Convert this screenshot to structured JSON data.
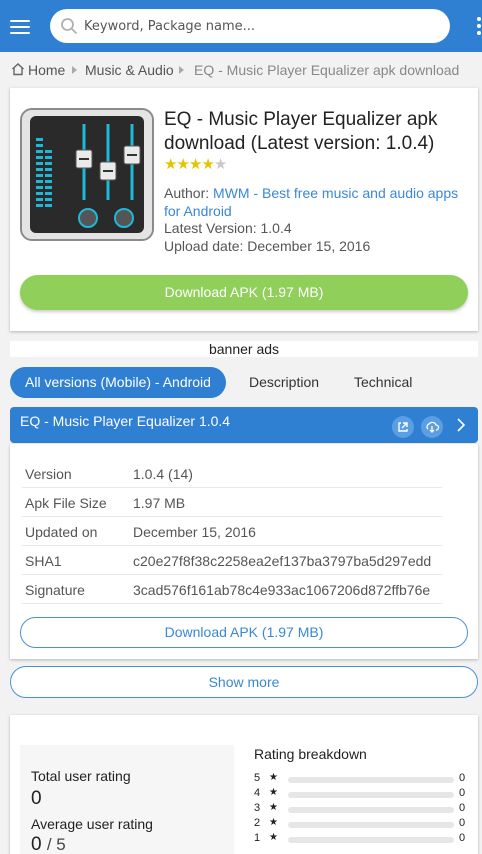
{
  "search": {
    "placeholder": "Keyword, Package name..."
  },
  "breadcrumb": {
    "home": "Home",
    "category": "Music & Audio",
    "current": "EQ - Music Player Equalizer apk download"
  },
  "app": {
    "title": "EQ - Music Player Equalizer apk download (Latest version: 1.0.4)",
    "rating_stars": 4,
    "rating_max": 5,
    "author_label": "Author:",
    "author_name": "MWM - Best free music and audio apps for Android",
    "latest_version": "Latest Version: 1.0.4",
    "upload_date": "Upload date: December 15, 2016",
    "download_label": "Download APK (1.97 MB)"
  },
  "banner_text": "banner ads",
  "tabs": [
    {
      "label": "All versions (Mobile) - Android"
    },
    {
      "label": "Description"
    },
    {
      "label": "Technical"
    }
  ],
  "version_bar": {
    "title": "EQ - Music Player Equalizer 1.0.4"
  },
  "details": [
    {
      "key": "Version",
      "value": "1.0.4 (14)"
    },
    {
      "key": "Apk File Size",
      "value": "1.97 MB"
    },
    {
      "key": "Updated on",
      "value": "December 15, 2016"
    },
    {
      "key": "SHA1",
      "value": "c20e27f8f38c2258ea2ef137ba3797ba5d297edd"
    },
    {
      "key": "Signature",
      "value": "3cad576f161ab78c4e933ac1067206d872ffb76e"
    }
  ],
  "detail_download_label": "Download APK (1.97 MB)",
  "show_more_label": "Show more",
  "rating": {
    "total_label": "Total user rating",
    "total_value": "0",
    "average_label": "Average user rating",
    "average_value": "0",
    "average_suffix": "/ 5",
    "breakdown_title": "Rating breakdown",
    "star_glyph": "★",
    "rows": [
      {
        "stars": "5",
        "count": "0"
      },
      {
        "stars": "4",
        "count": "0"
      },
      {
        "stars": "3",
        "count": "0"
      },
      {
        "stars": "2",
        "count": "0"
      },
      {
        "stars": "1",
        "count": "0"
      }
    ]
  },
  "colors": {
    "brand": "#2f7fd3",
    "download_green": "#8fcf5a",
    "star_gold": "#e5c400",
    "link": "#3a87d6"
  }
}
